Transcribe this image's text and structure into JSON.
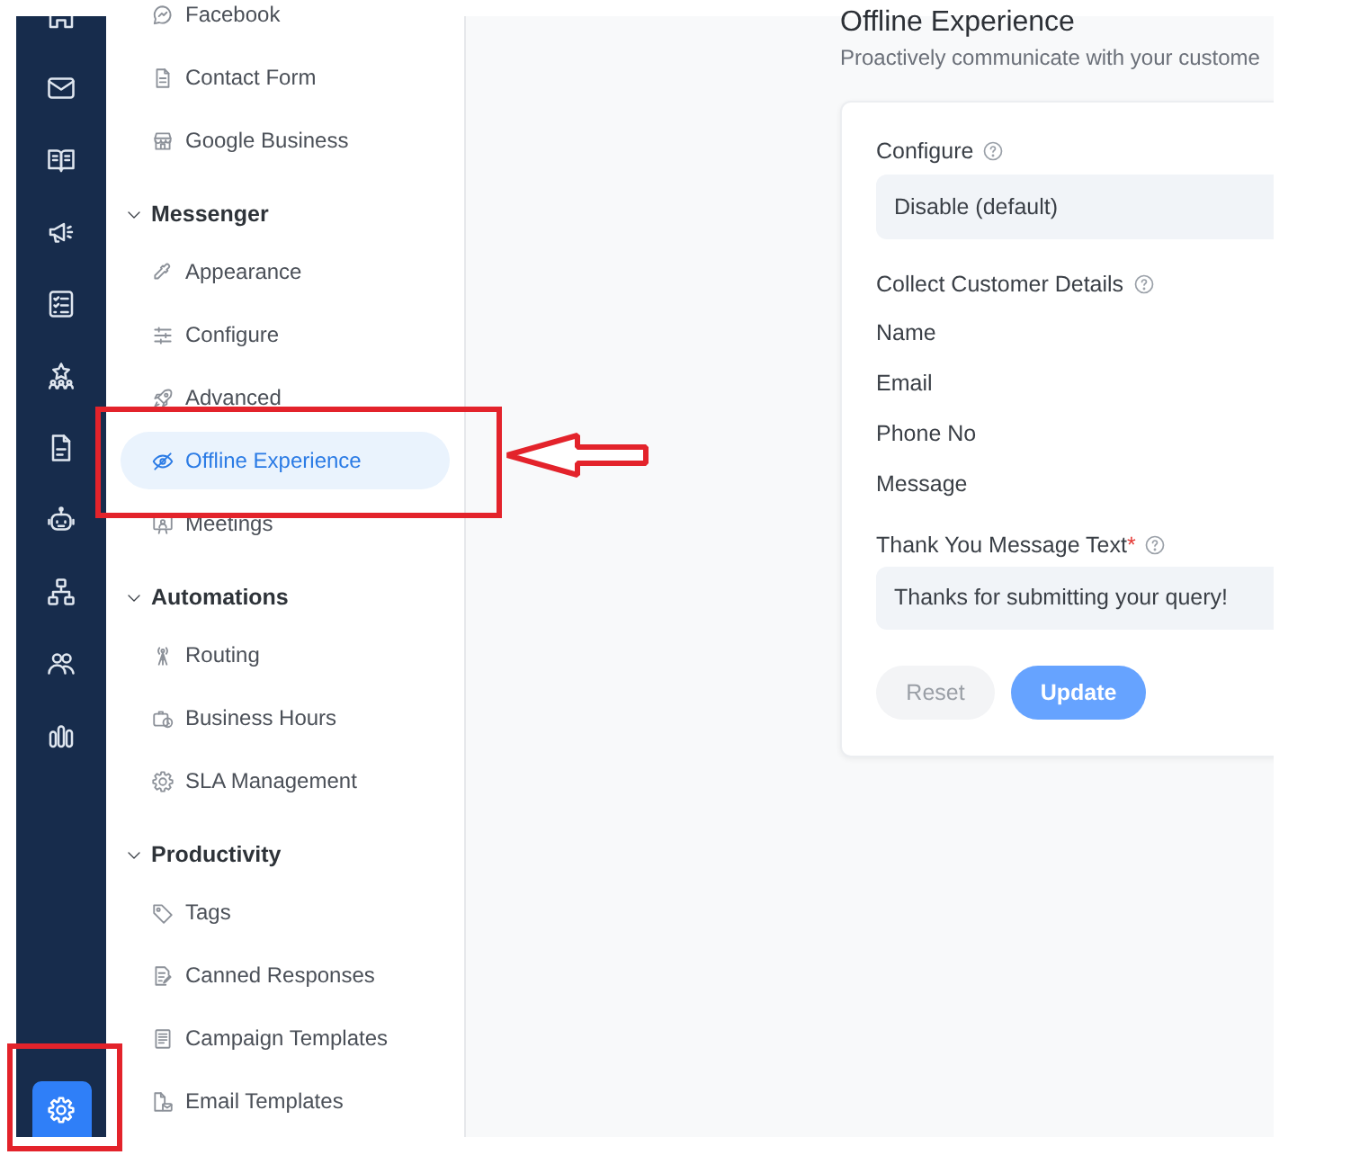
{
  "rail": {
    "items": [
      {
        "selected": false
      },
      {
        "selected": false
      },
      {
        "selected": false
      },
      {
        "selected": false
      },
      {
        "selected": false
      },
      {
        "selected": false
      },
      {
        "selected": false
      },
      {
        "selected": false
      },
      {
        "selected": false
      },
      {
        "selected": false
      },
      {
        "selected": false
      }
    ],
    "footer_button": {
      "selected": true,
      "callout": true
    }
  },
  "settings_nav": {
    "items": [
      {
        "label": "Facebook",
        "selected": false,
        "callout": false
      },
      {
        "label": "Contact Form",
        "selected": false,
        "callout": false
      },
      {
        "label": "Google Business",
        "selected": false,
        "callout": false
      }
    ],
    "sections": [
      {
        "title": "Messenger",
        "expanded": true,
        "items": [
          {
            "label": "Appearance",
            "selected": false,
            "callout": false
          },
          {
            "label": "Configure",
            "selected": false,
            "callout": false
          },
          {
            "label": "Advanced",
            "selected": false,
            "callout": false
          },
          {
            "label": "Offline Experience",
            "selected": true,
            "callout": true
          },
          {
            "label": "Meetings",
            "selected": false,
            "callout": false
          }
        ]
      },
      {
        "title": "Automations",
        "expanded": true,
        "items": [
          {
            "label": "Routing",
            "selected": false,
            "callout": false
          },
          {
            "label": "Business Hours",
            "selected": false,
            "callout": false
          },
          {
            "label": "SLA Management",
            "selected": false,
            "callout": false
          }
        ]
      },
      {
        "title": "Productivity",
        "expanded": true,
        "items": [
          {
            "label": "Tags",
            "selected": false,
            "callout": false
          },
          {
            "label": "Canned Responses",
            "selected": false,
            "callout": false
          },
          {
            "label": "Campaign Templates",
            "selected": false,
            "callout": false
          },
          {
            "label": "Email Templates",
            "selected": false,
            "callout": false
          }
        ]
      }
    ]
  },
  "page": {
    "title": "Offline Experience",
    "subtitle": "Proactively communicate with your custome"
  },
  "form": {
    "configure": {
      "label": "Configure",
      "value": "Disable (default)"
    },
    "customer_details": {
      "label": "Collect Customer Details",
      "fields": [
        "Name",
        "Email",
        "Phone No",
        "Message"
      ]
    },
    "thank_you_message": {
      "label": "Thank You Message Text",
      "required_mark": "*",
      "value": "Thanks for submitting your query!"
    },
    "buttons": [
      {
        "label": "Reset",
        "kind": "secondary",
        "disabled": true
      },
      {
        "label": "Update",
        "kind": "primary",
        "disabled": true
      }
    ]
  }
}
